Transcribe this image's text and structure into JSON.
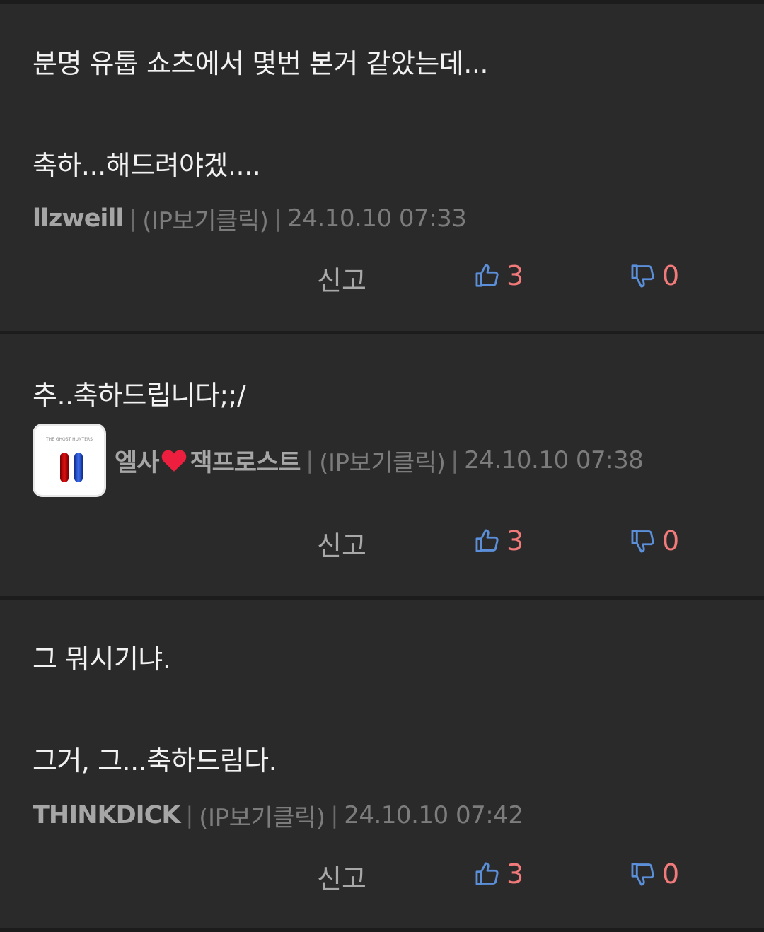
{
  "comments": [
    {
      "text": "분명 유툽 쇼츠에서 몇번 본거 같았는데...\n\n축하...해드려야겠....",
      "author": "llzweill",
      "ip": "(IP보기클릭)",
      "date": "24.10.10 07:33",
      "report_label": "신고",
      "likes": "3",
      "dislikes": "0"
    },
    {
      "text": "추..축하드립니다;;/",
      "author_prefix": "엘사",
      "author_suffix": "잭프로스트",
      "avatar_caption": "THE GHOST HUNTERS",
      "ip": "(IP보기클릭)",
      "date": "24.10.10 07:38",
      "report_label": "신고",
      "likes": "3",
      "dislikes": "0"
    },
    {
      "text": "그 뭐시기냐.\n\n그거, 그...축하드림다.",
      "author": "THINKDICK",
      "ip": "(IP보기클릭)",
      "date": "24.10.10 07:42",
      "report_label": "신고",
      "likes": "3",
      "dislikes": "0"
    }
  ],
  "separator": "|",
  "colors": {
    "background": "#2a2a2a",
    "divider": "#1c1c1c",
    "text": "#f2f2f2",
    "meta": "#7c7c7c",
    "author": "#a6a6a6",
    "count": "#f27a7a",
    "thumb_icon": "#5b8fd9"
  },
  "icons": {
    "like": "thumbs-up-icon",
    "dislike": "thumbs-down-icon",
    "heart": "heart-icon"
  }
}
